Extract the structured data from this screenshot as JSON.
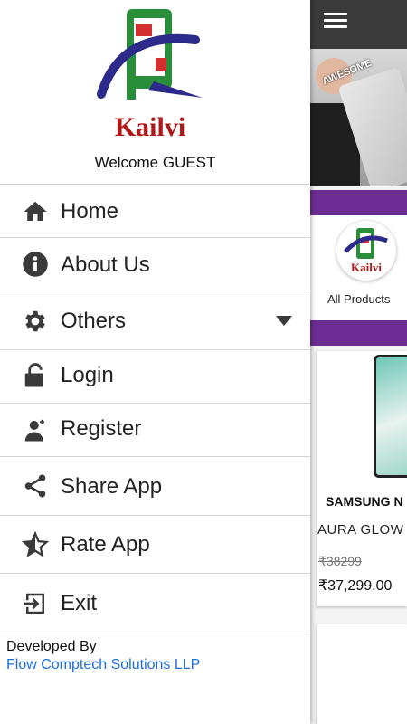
{
  "drawer": {
    "brand": "Kailvi",
    "welcome": "Welcome GUEST",
    "items": [
      {
        "label": "Home",
        "icon": "home-icon"
      },
      {
        "label": "About Us",
        "icon": "info-icon"
      },
      {
        "label": "Others",
        "icon": "gear-icon"
      },
      {
        "label": "Login",
        "icon": "unlock-icon"
      },
      {
        "label": "Register",
        "icon": "add-user-icon"
      },
      {
        "label": "Share App",
        "icon": "share-icon"
      },
      {
        "label": "Rate App",
        "icon": "star-half-icon"
      },
      {
        "label": "Exit",
        "icon": "exit-icon"
      }
    ],
    "footer": {
      "developed_by": "Developed By",
      "company": "Flow Comptech Solutions LLP"
    }
  },
  "app": {
    "banner_text": "AWESOME",
    "category_label": "All Products",
    "product": {
      "name": "SAMSUNG N",
      "subtitle": "AURA GLOW",
      "old_price": "₹38299",
      "price": "₹37,299.00"
    }
  },
  "colors": {
    "accent_purple": "#6b2d91",
    "link_blue": "#1e6fd9",
    "topbar": "#3a3a3a"
  }
}
